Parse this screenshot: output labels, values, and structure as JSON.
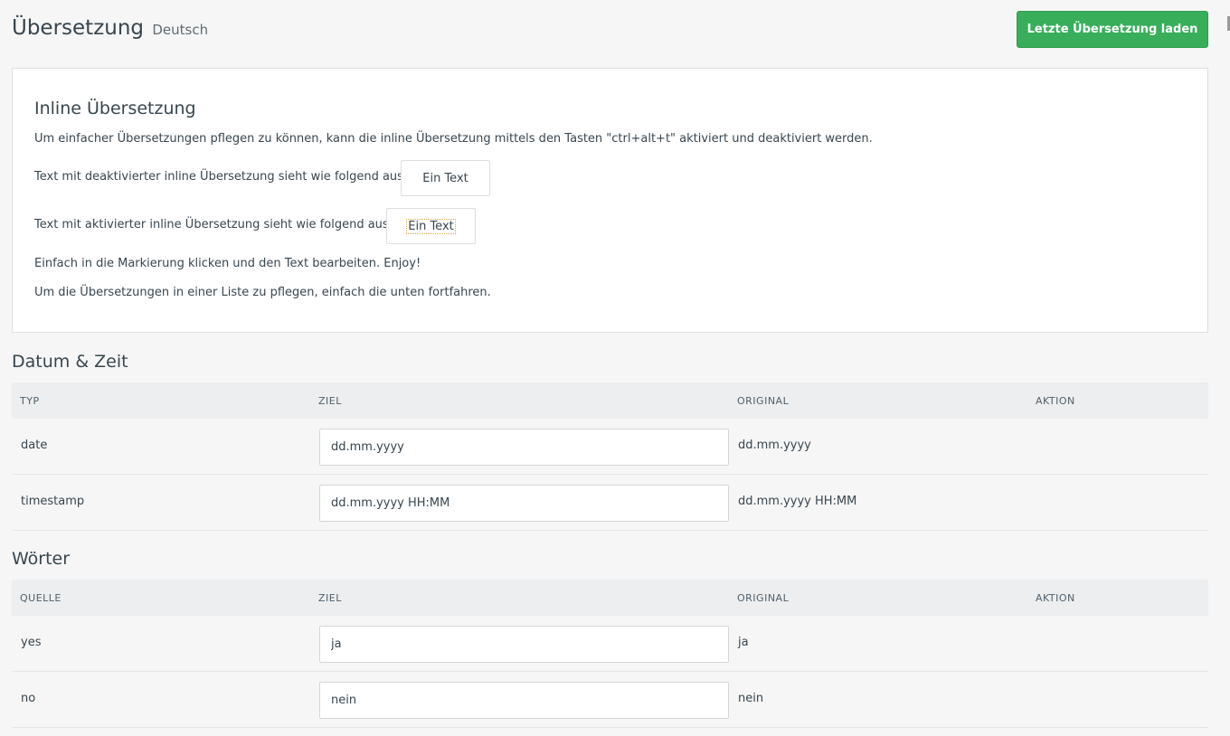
{
  "header": {
    "title": "Übersetzung",
    "language": "Deutsch",
    "load_button": "Letzte Übersetzung laden"
  },
  "inline": {
    "title": "Inline Übersetzung",
    "description": "Um einfacher Übersetzungen pflegen zu können, kann die inline Übersetzung mittels den Tasten \"ctrl+alt+t\" aktiviert und deaktiviert werden.",
    "deactivated_label": "Text mit deaktivierter inline Übersetzung sieht wie folgend aus",
    "activated_label": "Text mit aktivierter inline Übersetzung sieht wie folgend aus",
    "sample_text": "Ein Text",
    "hint_edit": "Einfach in die Markierung klicken und den Text bearbeiten. Enjoy!",
    "hint_list": "Um die Übersetzungen in einer Liste zu pflegen, einfach die unten fortfahren."
  },
  "datetime": {
    "title": "Datum & Zeit",
    "columns": [
      "TYP",
      "ZIEL",
      "ORIGINAL",
      "AKTION"
    ],
    "rows": [
      {
        "type": "date",
        "target": "dd.mm.yyyy",
        "original": "dd.mm.yyyy"
      },
      {
        "type": "timestamp",
        "target": "dd.mm.yyyy HH:MM",
        "original": "dd.mm.yyyy HH:MM"
      }
    ]
  },
  "words": {
    "title": "Wörter",
    "columns": [
      "QUELLE",
      "ZIEL",
      "ORIGINAL",
      "AKTION"
    ],
    "rows": [
      {
        "source": "yes",
        "target": "ja",
        "original": "ja"
      },
      {
        "source": "no",
        "target": "nein",
        "original": "nein"
      }
    ]
  }
}
